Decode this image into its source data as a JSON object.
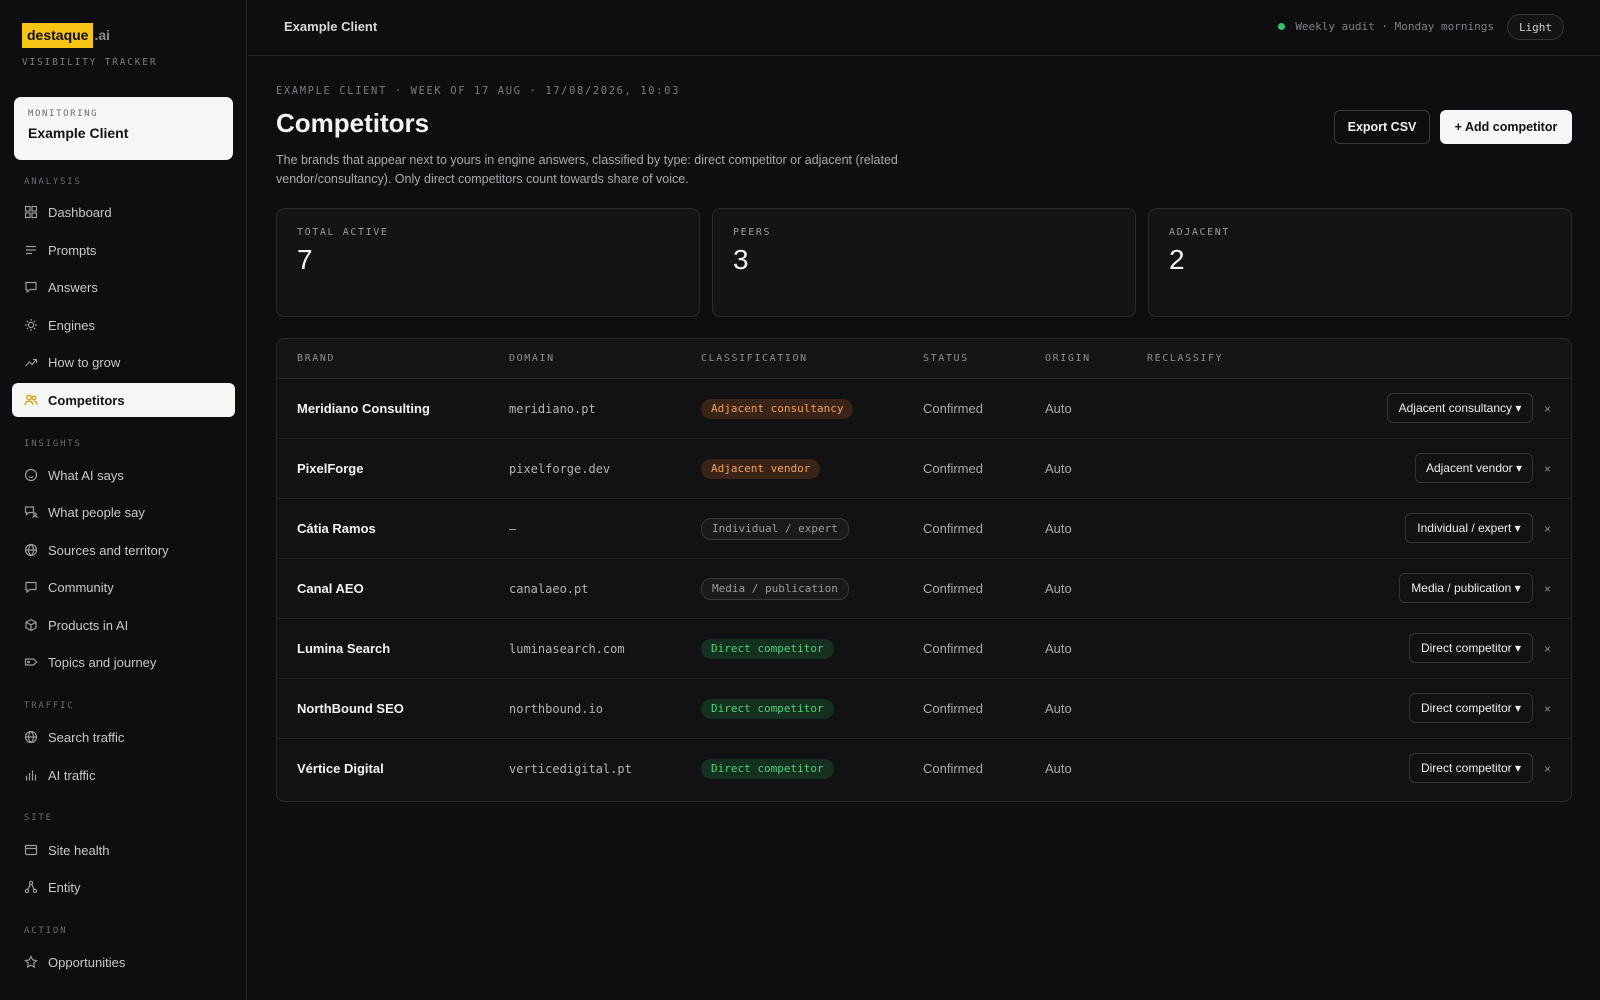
{
  "logo": {
    "name": "destaque",
    "suffix": ".ai",
    "subtitle": "VISIBILITY TRACKER"
  },
  "monitoring": {
    "label": "MONITORING",
    "client": "Example Client"
  },
  "sidebar": {
    "sections": [
      "ANALYSIS",
      "INSIGHTS",
      "TRAFFIC",
      "SITE",
      "ACTION"
    ],
    "items": [
      {
        "label": "Dashboard",
        "icon": "grid-icon"
      },
      {
        "label": "Prompts",
        "icon": "lines-icon"
      },
      {
        "label": "Answers",
        "icon": "chat-icon"
      },
      {
        "label": "Engines",
        "icon": "sun-icon"
      },
      {
        "label": "How to grow",
        "icon": "trend-up-icon"
      },
      {
        "label": "Competitors",
        "icon": "users-icon",
        "active": true
      },
      {
        "label": "What AI says",
        "icon": "smile-icon"
      },
      {
        "label": "What people say",
        "icon": "people-chat-icon"
      },
      {
        "label": "Sources and territory",
        "icon": "globe-icon"
      },
      {
        "label": "Community",
        "icon": "chat-icon"
      },
      {
        "label": "Products in AI",
        "icon": "cube-icon"
      },
      {
        "label": "Topics and journey",
        "icon": "tag-icon"
      },
      {
        "label": "Search traffic",
        "icon": "globe-icon"
      },
      {
        "label": "AI traffic",
        "icon": "bar-chart-icon"
      },
      {
        "label": "Site health",
        "icon": "card-icon"
      },
      {
        "label": "Entity",
        "icon": "nodes-icon"
      },
      {
        "label": "Opportunities",
        "icon": "star-icon"
      }
    ]
  },
  "topbar": {
    "breadcrumb": "Example Client",
    "audit": "Weekly audit · Monday mornings",
    "theme_toggle": "Light"
  },
  "page": {
    "meta": "EXAMPLE CLIENT · WEEK OF 17 AUG · 17/08/2026, 10:03",
    "title": "Competitors",
    "description": "The brands that appear next to yours in engine answers, classified by type: direct competitor or adjacent (related vendor/consultancy). Only direct competitors count towards share of voice.",
    "export_label": "Export CSV",
    "add_label": "+ Add competitor"
  },
  "stats": [
    {
      "label": "TOTAL ACTIVE",
      "value": "7"
    },
    {
      "label": "PEERS",
      "value": "3"
    },
    {
      "label": "ADJACENT",
      "value": "2"
    }
  ],
  "table": {
    "headers": [
      "BRAND",
      "DOMAIN",
      "CLASSIFICATION",
      "STATUS",
      "ORIGIN",
      "RECLASSIFY"
    ],
    "rows": [
      {
        "brand": "Meridiano Consulting",
        "domain": "meridiano.pt",
        "classification": "Adjacent consultancy",
        "status": "Confirmed",
        "origin": "Auto",
        "reclassify": "Adjacent consultancy ▾",
        "remove": "×"
      },
      {
        "brand": "PixelForge",
        "domain": "pixelforge.dev",
        "classification": "Adjacent vendor",
        "status": "Confirmed",
        "origin": "Auto",
        "reclassify": "Adjacent vendor ▾",
        "remove": "×"
      },
      {
        "brand": "Cátia Ramos",
        "domain": "—",
        "classification": "Individual / expert",
        "status": "Confirmed",
        "origin": "Auto",
        "reclassify": "Individual / expert ▾",
        "remove": "×"
      },
      {
        "brand": "Canal AEO",
        "domain": "canalaeo.pt",
        "classification": "Media / publication",
        "status": "Confirmed",
        "origin": "Auto",
        "reclassify": "Media / publication ▾",
        "remove": "×"
      },
      {
        "brand": "Lumina Search",
        "domain": "luminasearch.com",
        "classification": "Direct competitor",
        "status": "Confirmed",
        "origin": "Auto",
        "reclassify": "Direct competitor ▾",
        "remove": "×"
      },
      {
        "brand": "NorthBound SEO",
        "domain": "northbound.io",
        "classification": "Direct competitor",
        "status": "Confirmed",
        "origin": "Auto",
        "reclassify": "Direct competitor ▾",
        "remove": "×"
      },
      {
        "brand": "Vértice Digital",
        "domain": "verticedigital.pt",
        "classification": "Direct competitor",
        "status": "Confirmed",
        "origin": "Auto",
        "reclassify": "Direct competitor ▾",
        "remove": "×"
      }
    ]
  },
  "colors": {
    "accent": "#f6c414",
    "status_dot": "#33c26a",
    "adjacent": "#f0a060",
    "direct": "#52d07c"
  }
}
